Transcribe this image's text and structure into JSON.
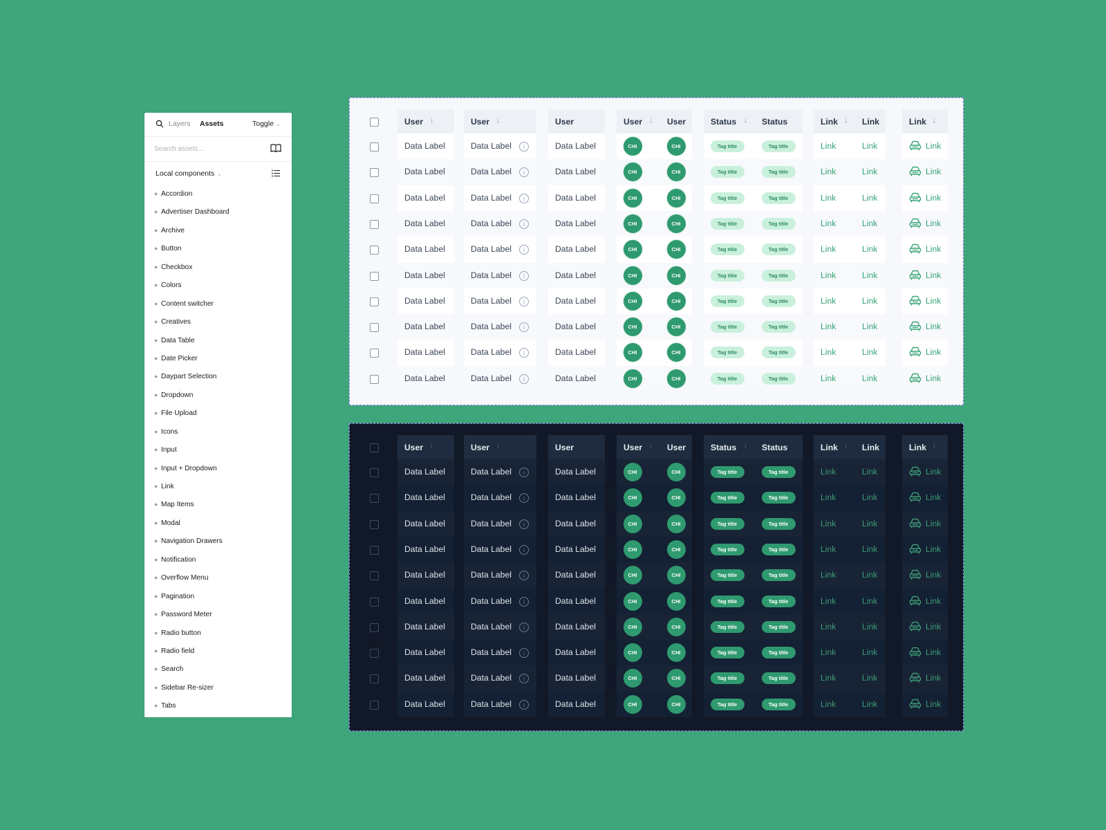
{
  "assets_panel": {
    "tabs": {
      "layers": "Layers",
      "assets": "Assets"
    },
    "toggle_label": "Toggle",
    "search_placeholder": "Search assets...",
    "section_label": "Local components",
    "components": [
      "Accordion",
      "Advertiser Dashboard",
      "Archive",
      "Button",
      "Checkbox",
      "Colors",
      "Content switcher",
      "Creatives",
      "Data Table",
      "Date Picker",
      "Daypart Selection",
      "Dropdown",
      "File Upload",
      "Icons",
      "Input",
      "Input + Dropdown",
      "Link",
      "Map Items",
      "Modal",
      "Navigation Drawers",
      "Notification",
      "Overflow Menu",
      "Pagination",
      "Password Meter",
      "Radio button",
      "Radio field",
      "Search",
      "Sidebar Re-sizer",
      "Tabs"
    ]
  },
  "tables": {
    "headers": [
      "User",
      "User",
      "User",
      "User",
      "User",
      "Status",
      "Status",
      "Link",
      "Link",
      "Link"
    ],
    "sortable": [
      true,
      true,
      false,
      true,
      false,
      true,
      false,
      true,
      false,
      true
    ],
    "sort_arrow": "↓",
    "row_count": 10,
    "cells": {
      "data_label": "Data Label",
      "info_glyph": "i",
      "avatar_initials": "CHI",
      "tag": "Tag title",
      "link": "Link"
    },
    "icons": [
      "search-icon",
      "book-icon",
      "list-icon",
      "info-icon",
      "car-icon",
      "sort-arrow-icon"
    ],
    "colors": {
      "background": "#3fa57a",
      "accent": "#2f9a6f",
      "light_tag_bg": "#c9f0dc",
      "dark_bg": "#111827",
      "frame_border": "#9b7cf6"
    }
  }
}
